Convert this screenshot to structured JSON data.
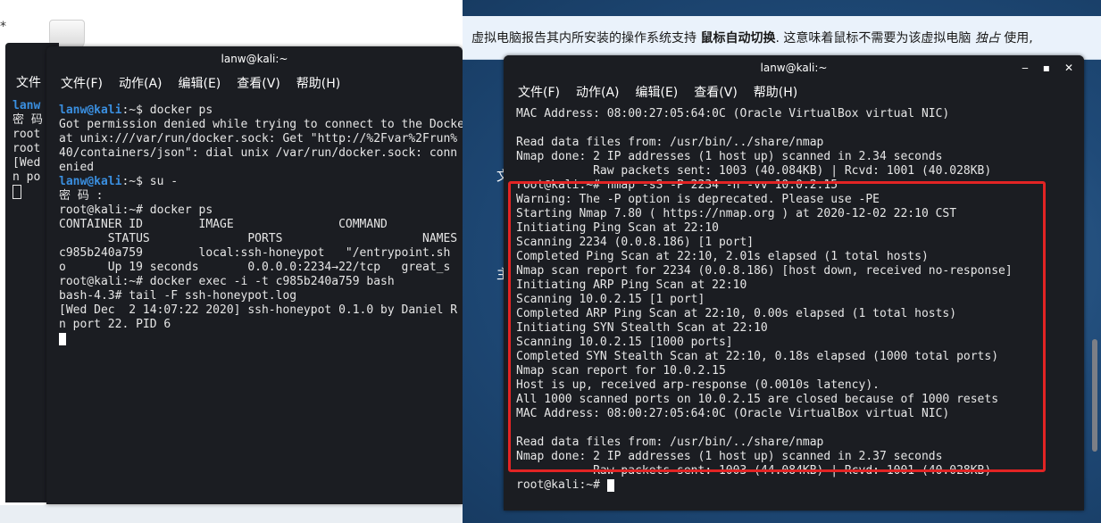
{
  "desktop_left": {
    "star": "*"
  },
  "bg_terminal": {
    "menu_label": "文件",
    "lines": [
      "lanw",
      "密 码",
      "root",
      "root",
      "[Wed",
      "n po"
    ]
  },
  "left_terminal": {
    "title": "lanw@kali:~",
    "menu": [
      "文件(F)",
      "动作(A)",
      "编辑(E)",
      "查看(V)",
      "帮助(H)"
    ],
    "lines": [
      {
        "user": "lanw@kali",
        "rest": ":~$ docker ps"
      },
      {
        "text": "Got permission denied while trying to connect to the Docker"
      },
      {
        "text": "at unix:///var/run/docker.sock: Get \"http://%2Fvar%2Frun%"
      },
      {
        "text": "40/containers/json\": dial unix /var/run/docker.sock: conn"
      },
      {
        "text": "enied"
      },
      {
        "user": "lanw@kali",
        "rest": ":~$ su -"
      },
      {
        "text": "密 码 :"
      },
      {
        "text": "root@kali:~# docker ps"
      },
      {
        "text": "CONTAINER ID        IMAGE               COMMAND"
      },
      {
        "text": "       STATUS              PORTS                    NAMES"
      },
      {
        "text": "c985b240a759        local:ssh-honeypot   \"/entrypoint.sh"
      },
      {
        "text": "o      Up 19 seconds       0.0.0.0:2234→22/tcp   great_s"
      },
      {
        "text": "root@kali:~# docker exec -i -t c985b240a759 bash"
      },
      {
        "text": "bash-4.3# tail -F ssh-honeypot.log"
      },
      {
        "text": "[Wed Dec  2 14:07:22 2020] ssh-honeypot 0.1.0 by Daniel R"
      },
      {
        "text": "n port 22. PID 6"
      }
    ]
  },
  "notification": {
    "part1": "虚拟电脑报告其内所安装的操作系统支持",
    "bold": "鼠标自动切换",
    "part2": ". 这意味着鼠标不需要为该虚拟电脑",
    "italic": "独占",
    "part3": "使用,"
  },
  "desktop_right": {
    "glyph1": "文",
    "glyph2": "主"
  },
  "right_terminal": {
    "title": "lanw@kali:~",
    "controls": [
      "‒",
      "▪",
      "✕"
    ],
    "menu": [
      "文件(F)",
      "动作(A)",
      "编辑(E)",
      "查看(V)",
      "帮助(H)"
    ],
    "lines": [
      "MAC Address: 08:00:27:05:64:0C (Oracle VirtualBox virtual NIC)",
      "",
      "Read data files from: /usr/bin/../share/nmap",
      "Nmap done: 2 IP addresses (1 host up) scanned in 2.34 seconds",
      "           Raw packets sent: 1003 (40.084KB) | Rcvd: 1001 (40.028KB)",
      "root@kali:~# nmap -sS -P 2234 -n -vv 10.0.2.15",
      "Warning: The -P option is deprecated. Please use -PE",
      "Starting Nmap 7.80 ( https://nmap.org ) at 2020-12-02 22:10 CST",
      "Initiating Ping Scan at 22:10",
      "Scanning 2234 (0.0.8.186) [1 port]",
      "Completed Ping Scan at 22:10, 2.01s elapsed (1 total hosts)",
      "Nmap scan report for 2234 (0.0.8.186) [host down, received no-response]",
      "Initiating ARP Ping Scan at 22:10",
      "Scanning 10.0.2.15 [1 port]",
      "Completed ARP Ping Scan at 22:10, 0.00s elapsed (1 total hosts)",
      "Initiating SYN Stealth Scan at 22:10",
      "Scanning 10.0.2.15 [1000 ports]",
      "Completed SYN Stealth Scan at 22:10, 0.18s elapsed (1000 total ports)",
      "Nmap scan report for 10.0.2.15",
      "Host is up, received arp-response (0.0010s latency).",
      "All 1000 scanned ports on 10.0.2.15 are closed because of 1000 resets",
      "MAC Address: 08:00:27:05:64:0C (Oracle VirtualBox virtual NIC)",
      "",
      "Read data files from: /usr/bin/../share/nmap",
      "Nmap done: 2 IP addresses (1 host up) scanned in 2.37 seconds",
      "           Raw packets sent: 1003 (44.084KB) | Rcvd: 1001 (40.028KB)"
    ],
    "final_prompt": "root@kali:~# "
  },
  "colors": {
    "terminal_bg": "#1b1d22",
    "prompt_blue": "#3a8fe0",
    "highlight_red": "#e22424",
    "desktop_blue": "#1f4a78"
  }
}
